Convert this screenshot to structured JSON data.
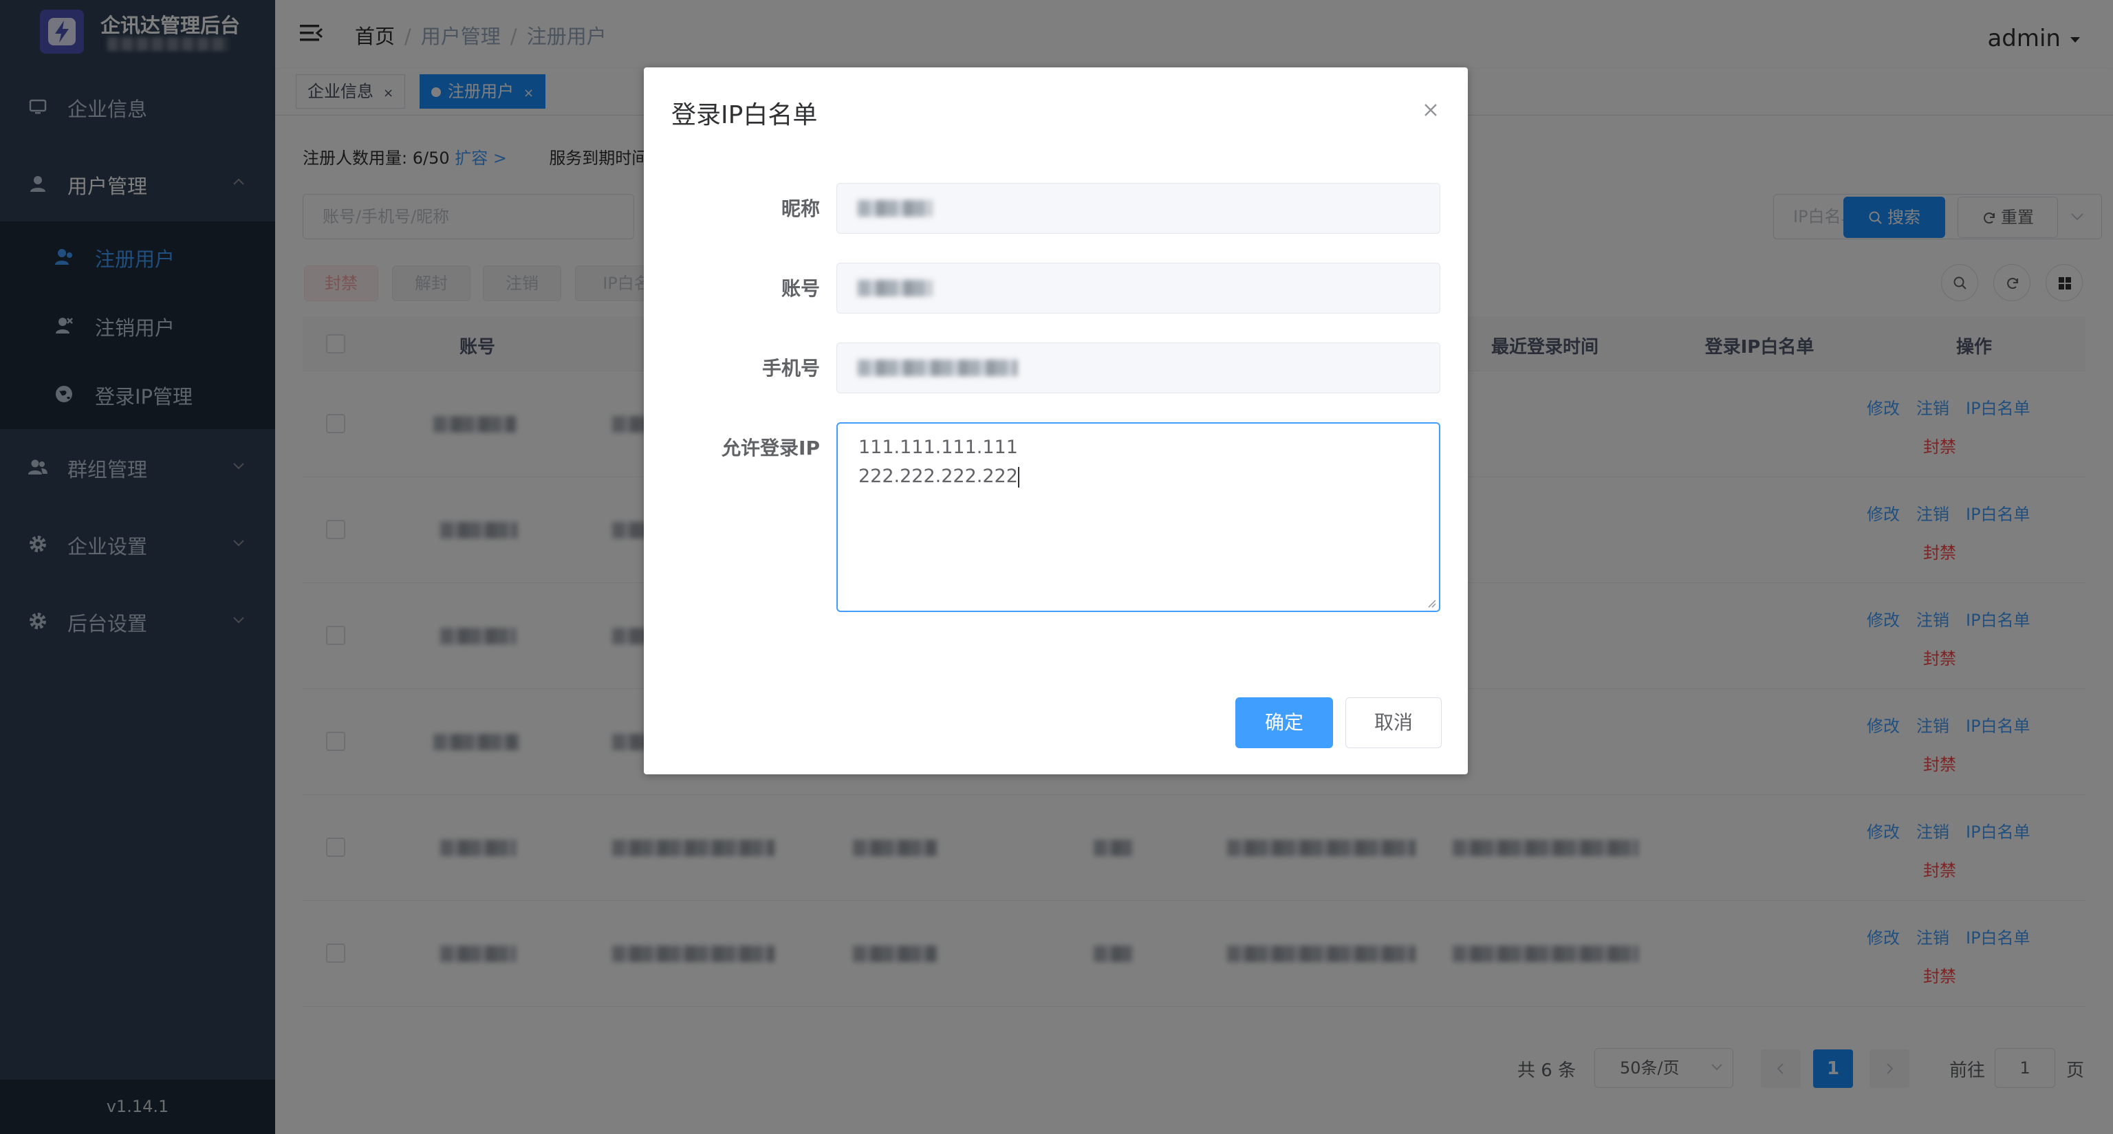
{
  "app": {
    "title": "企讯达管理后台",
    "version": "v1.14.1"
  },
  "sidebar": {
    "items": [
      {
        "label": "企业信息",
        "icon": "monitor-icon"
      },
      {
        "label": "用户管理",
        "icon": "user-icon",
        "expanded": true
      },
      {
        "label": "群组管理",
        "icon": "users-icon"
      },
      {
        "label": "企业设置",
        "icon": "gear-icon"
      },
      {
        "label": "后台设置",
        "icon": "gear-icon"
      }
    ],
    "subitems": [
      {
        "label": "注册用户",
        "icon": "user-check-icon",
        "active": true
      },
      {
        "label": "注销用户",
        "icon": "user-x-icon"
      },
      {
        "label": "登录IP管理",
        "icon": "globe-icon"
      }
    ]
  },
  "header": {
    "breadcrumb": [
      "首页",
      "用户管理",
      "注册用户"
    ],
    "separator": "/",
    "user": "admin"
  },
  "tags": [
    {
      "label": "企业信息",
      "close": "×"
    },
    {
      "label": "注册用户",
      "close": "×",
      "active": true
    }
  ],
  "main": {
    "usage_label": "注册人数用量:",
    "usage_value": "6/50",
    "expand_link": "扩容 >",
    "service_label": "服务到期时间:",
    "search_placeholder": "账号/手机号/昵称",
    "ip_select_placeholder": "IP白名单",
    "search_button": "搜索",
    "reset_button": "重置",
    "actions": [
      "封禁",
      "解封",
      "注销",
      "IP白名"
    ],
    "columns": [
      "账号",
      "最近登录时间",
      "登录IP白名单",
      "操作"
    ],
    "row_actions": {
      "edit": "修改",
      "cancel": "注销",
      "whitelist": "IP白名单",
      "ban": "封禁"
    },
    "row_count": 6
  },
  "pagination": {
    "total": "共 6 条",
    "page_size": "50条/页",
    "current_page": "1",
    "goto_label": "前往",
    "goto_value": "1",
    "page_suffix": "页"
  },
  "dialog": {
    "title": "登录IP白名单",
    "labels": {
      "nickname": "昵称",
      "account": "账号",
      "phone": "手机号",
      "allowed_ip": "允许登录IP"
    },
    "allowed_ips": [
      "111.111.111.111",
      "222.222.222.222"
    ],
    "confirm": "确定",
    "cancel": "取消"
  },
  "colors": {
    "sidebar_bg": "#304156",
    "submenu_bg": "#1f2d3d",
    "primary": "#409eff",
    "danger": "#ff4949"
  }
}
